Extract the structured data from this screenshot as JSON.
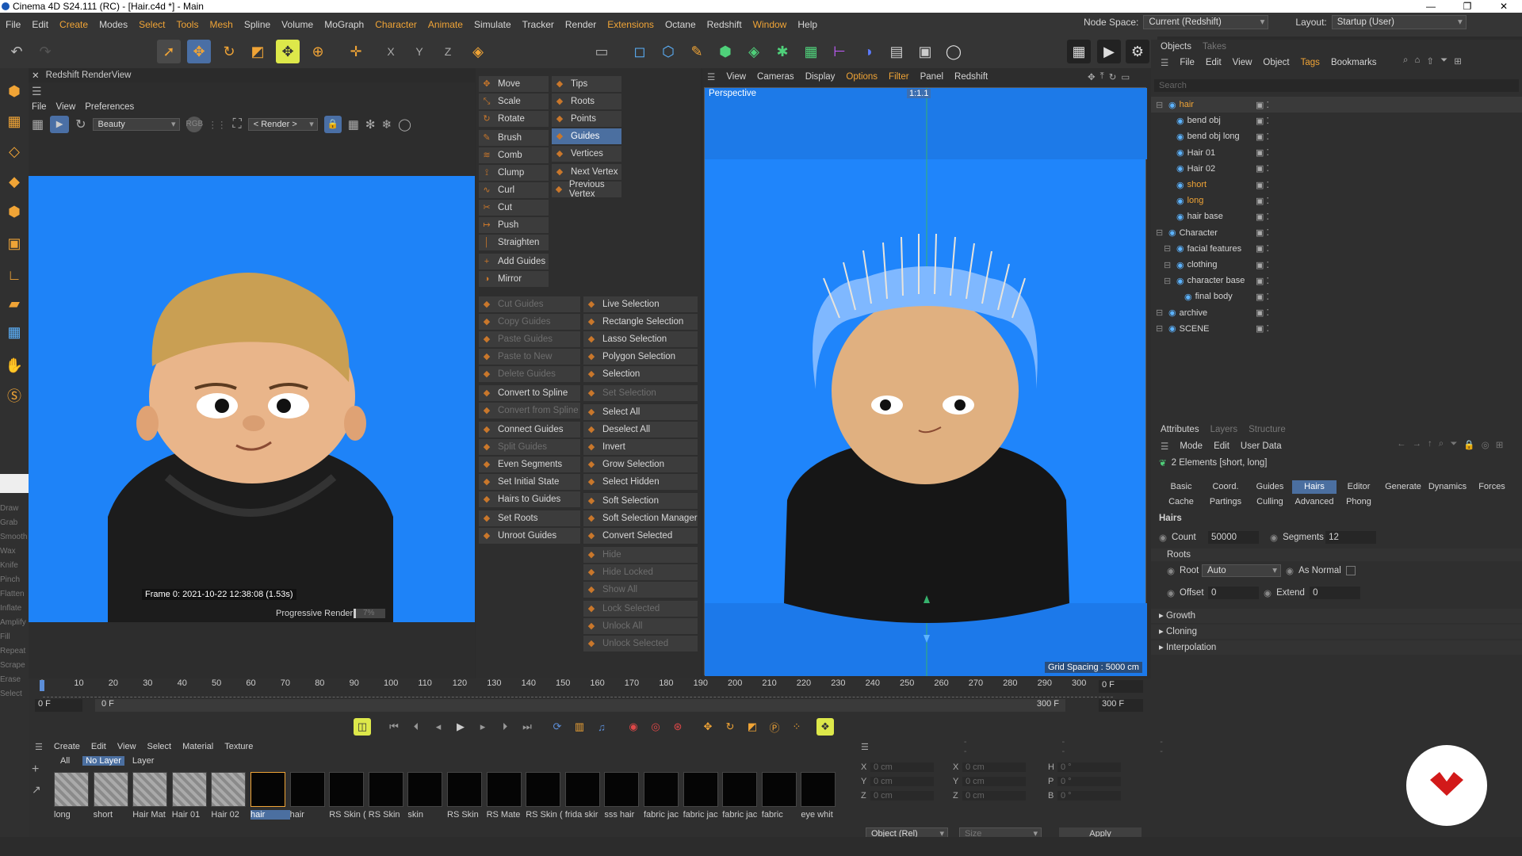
{
  "window": {
    "title": "Cinema 4D S24.111 (RC) - [Hair.c4d *] - Main",
    "controls": [
      "—",
      "❐",
      "✕"
    ]
  },
  "menu": [
    {
      "label": "File"
    },
    {
      "label": "Edit"
    },
    {
      "label": "Create",
      "hl": true
    },
    {
      "label": "Modes"
    },
    {
      "label": "Select",
      "hl": true
    },
    {
      "label": "Tools",
      "hl": true
    },
    {
      "label": "Mesh",
      "hl": true
    },
    {
      "label": "Spline"
    },
    {
      "label": "Volume"
    },
    {
      "label": "MoGraph"
    },
    {
      "label": "Character",
      "hl": true
    },
    {
      "label": "Animate",
      "hl": true
    },
    {
      "label": "Simulate"
    },
    {
      "label": "Tracker"
    },
    {
      "label": "Render"
    },
    {
      "label": "Extensions",
      "hl": true
    },
    {
      "label": "Octane"
    },
    {
      "label": "Redshift"
    },
    {
      "label": "Window",
      "hl": true
    },
    {
      "label": "Help"
    }
  ],
  "nodespace": {
    "label": "Node Space:",
    "value": "Current (Redshift)"
  },
  "layout": {
    "label": "Layout:",
    "value": "Startup (User)"
  },
  "renderview": {
    "title": "Redshift RenderView",
    "menu": [
      "File",
      "View",
      "Preferences"
    ],
    "beauty": "Beauty",
    "render_dd": "< Render >",
    "frame_info": "Frame  0:  2021-10-22  12:38:08  (1.53s)",
    "progress_label": "Progressive Rendering...",
    "progress_pct": "7%",
    "progress_value": 0.07
  },
  "sculpt_tools": [
    "Draw",
    "Grab",
    "Smooth",
    "Wax",
    "Knife",
    "Pinch",
    "Flatten",
    "Inflate",
    "Amplify",
    "Fill",
    "Repeat",
    "Scrape",
    "Erase",
    "Select"
  ],
  "hair_tools": {
    "col1": [
      {
        "label": "Move"
      },
      {
        "label": "Scale"
      },
      {
        "label": "Rotate"
      },
      {
        "label": "Brush"
      },
      {
        "label": "Comb"
      },
      {
        "label": "Clump"
      },
      {
        "label": "Curl"
      },
      {
        "label": "Cut"
      },
      {
        "label": "Push"
      },
      {
        "label": "Straighten"
      },
      {
        "label": "Add Guides"
      },
      {
        "label": "Mirror"
      }
    ],
    "col2": [
      {
        "label": "Tips"
      },
      {
        "label": "Roots"
      },
      {
        "label": "Points"
      },
      {
        "label": "Guides"
      },
      {
        "label": "Vertices"
      },
      {
        "label": "Next Vertex"
      },
      {
        "label": "Previous Vertex"
      }
    ],
    "col3": [
      {
        "label": "Cut Guides",
        "dis": true
      },
      {
        "label": "Copy Guides",
        "dis": true
      },
      {
        "label": "Paste Guides",
        "dis": true
      },
      {
        "label": "Paste to New",
        "dis": true
      },
      {
        "label": "Delete Guides",
        "dis": true
      },
      {
        "label": "Convert to Spline"
      },
      {
        "label": "Convert from Spline",
        "dis": true
      },
      {
        "label": "Connect Guides"
      },
      {
        "label": "Split Guides",
        "dis": true
      },
      {
        "label": "Even Segments"
      },
      {
        "label": "Set Initial State"
      },
      {
        "label": "Hairs to Guides"
      },
      {
        "label": "Set Roots"
      },
      {
        "label": "Unroot Guides"
      }
    ],
    "col4": [
      {
        "label": "Live Selection"
      },
      {
        "label": "Rectangle Selection"
      },
      {
        "label": "Lasso Selection"
      },
      {
        "label": "Polygon Selection"
      },
      {
        "label": "Selection"
      },
      {
        "label": "Set Selection",
        "dis": true
      },
      {
        "label": "Select All"
      },
      {
        "label": "Deselect All"
      },
      {
        "label": "Invert"
      },
      {
        "label": "Grow Selection"
      },
      {
        "label": "Select Hidden"
      },
      {
        "label": "Soft Selection"
      },
      {
        "label": "Soft Selection Manager"
      },
      {
        "label": "Convert Selected"
      },
      {
        "label": "Hide",
        "dis": true
      },
      {
        "label": "Hide Locked",
        "dis": true
      },
      {
        "label": "Show All",
        "dis": true
      },
      {
        "label": "Lock Selected",
        "dis": true
      },
      {
        "label": "Unlock All",
        "dis": true
      },
      {
        "label": "Unlock Selected",
        "dis": true
      }
    ]
  },
  "viewport": {
    "menu": [
      {
        "label": "View"
      },
      {
        "label": "Cameras"
      },
      {
        "label": "Display"
      },
      {
        "label": "Options",
        "hl": true
      },
      {
        "label": "Filter",
        "hl": true
      },
      {
        "label": "Panel"
      },
      {
        "label": "Redshift"
      }
    ],
    "name": "Perspective",
    "ratio": "1:1.1",
    "grid": "Grid Spacing : 5000 cm"
  },
  "objects": {
    "tabs": [
      "Objects",
      "Takes"
    ],
    "menu": [
      {
        "label": "File"
      },
      {
        "label": "Edit"
      },
      {
        "label": "View"
      },
      {
        "label": "Object"
      },
      {
        "label": "Tags",
        "hl": true
      },
      {
        "label": "Bookmarks"
      }
    ],
    "search": "Search",
    "rows": [
      {
        "name": "hair",
        "indent": 0,
        "color": "#f0a436",
        "sel": true
      },
      {
        "name": "bend obj",
        "indent": 1
      },
      {
        "name": "bend obj long",
        "indent": 1
      },
      {
        "name": "Hair 01",
        "indent": 1
      },
      {
        "name": "Hair 02",
        "indent": 1
      },
      {
        "name": "short",
        "indent": 1,
        "color": "#f0a436"
      },
      {
        "name": "long",
        "indent": 1,
        "color": "#f0a436"
      },
      {
        "name": "hair base",
        "indent": 1
      },
      {
        "name": "Character",
        "indent": 0
      },
      {
        "name": "facial features",
        "indent": 1
      },
      {
        "name": "clothing",
        "indent": 1
      },
      {
        "name": "character base",
        "indent": 1
      },
      {
        "name": "final body",
        "indent": 2
      },
      {
        "name": "archive",
        "indent": 0
      },
      {
        "name": "SCENE",
        "indent": 0
      }
    ]
  },
  "attributes": {
    "tabs": [
      "Attributes",
      "Layers",
      "Structure"
    ],
    "menu": [
      "Mode",
      "Edit",
      "User Data"
    ],
    "element_info": "2 Elements [short, long]",
    "tabs1": [
      {
        "label": "Basic"
      },
      {
        "label": "Coord."
      },
      {
        "label": "Guides"
      },
      {
        "label": "Hairs",
        "sel": true
      },
      {
        "label": "Editor"
      },
      {
        "label": "Generate"
      },
      {
        "label": "Dynamics"
      },
      {
        "label": "Forces"
      }
    ],
    "tabs2": [
      "Cache",
      "Partings",
      "Culling",
      "Advanced",
      "Phong"
    ],
    "section": "Hairs",
    "count_label": "Count",
    "count": "50000",
    "segments_label": "Segments",
    "segments": "12",
    "roots_group": "Roots",
    "root_label": "Root",
    "root_value": "Auto",
    "asnormal_label": "As Normal",
    "offset_label": "Offset",
    "offset": "0",
    "extend_label": "Extend",
    "extend": "0",
    "groups": [
      "Growth",
      "Cloning",
      "Interpolation"
    ]
  },
  "timeline": {
    "ticks": [
      "0",
      "10",
      "20",
      "30",
      "40",
      "50",
      "60",
      "70",
      "80",
      "90",
      "100",
      "110",
      "120",
      "130",
      "140",
      "150",
      "160",
      "170",
      "180",
      "190",
      "200",
      "210",
      "220",
      "230",
      "240",
      "250",
      "260",
      "270",
      "280",
      "290",
      "300"
    ],
    "frame_field": "0 F",
    "start": "0 F",
    "inner_start": "0 F",
    "end_inner": "300 F",
    "end": "300 F",
    "end2": "300 F"
  },
  "materials": {
    "menu": [
      "Create",
      "Edit",
      "View",
      "Select",
      "Material",
      "Texture"
    ],
    "filters": [
      "All",
      "No Layer",
      "Layer"
    ],
    "items": [
      "long",
      "short",
      "Hair Mat",
      "Hair 01",
      "Hair 02",
      "hair",
      "hair",
      "RS Skin (",
      "RS Skin",
      "skin",
      "RS Skin",
      "RS Mate",
      "RS Skin (",
      "frida skir",
      "sss hair",
      "fabric jac",
      "fabric jac",
      "fabric jac",
      "fabric",
      "eye whit"
    ]
  },
  "coords": {
    "rows": [
      [
        "X",
        "0 cm",
        "X",
        "0 cm",
        "H",
        "0 °"
      ],
      [
        "Y",
        "0 cm",
        "Y",
        "0 cm",
        "P",
        "0 °"
      ],
      [
        "Z",
        "0 cm",
        "Z",
        "0 cm",
        "B",
        "0 °"
      ]
    ],
    "mode": "Object (Rel)",
    "size": "Size",
    "apply": "Apply",
    "dash": "--"
  }
}
